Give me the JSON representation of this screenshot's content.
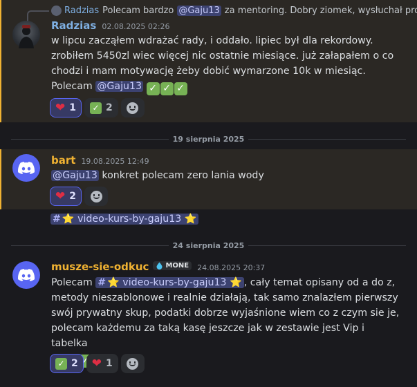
{
  "colors": {
    "mention_bg": "#2b2824",
    "mention_bar": "#f0b232",
    "blurple": "#5865f2"
  },
  "messages": [
    {
      "reply": {
        "author": "Radzias",
        "text_before": "Polecam bardzo",
        "mention": "@Gaju13",
        "text_after": "za mentoring. Dobry ziomek, wysłuchał pro..."
      },
      "author": "Radzias",
      "author_color": "#7fb0e3",
      "timestamp": "02.08.2025 02:26",
      "text": "w lipcu zacząłem wdrażać rady, i oddało. lipiec był dla rekordowy. zrobiłem 5450zl wiec więcej nic ostatnie miesiące. już załapałem o co chodzi i mam motywację żeby dobić wymarzone 10k w miesiąc. Polecam",
      "mention": "@Gaju13",
      "emoji_checks": 3,
      "reactions": [
        {
          "icon": "heart-icon",
          "count": "1",
          "me": true
        },
        {
          "icon": "check-icon",
          "count": "2",
          "me": false
        }
      ]
    },
    {
      "author": "bart",
      "author_color": "#f0b232",
      "timestamp": "19.08.2025 12:49",
      "mention": "@Gaju13",
      "text": "konkret polecam zero lania wody",
      "reactions": [
        {
          "icon": "heart-icon",
          "count": "2",
          "me": true
        }
      ]
    },
    {
      "author": "musze-sie-odkuc",
      "author_color": "#f0b232",
      "badge": "MONE",
      "timestamp": "24.08.2025 20:37",
      "text_before": "Polecam",
      "channel": "⭐ video-kurs-by-gaju13 ⭐",
      "text_after": ", cały temat opisany od a do z, metody nieszablonowe i realnie działają, tak samo znalazłem pierwszy swój prywatny skup, podatki dobrze wyjaśnione wiem co z czym sie je, polecam każdemu za taką kasę jeszcze jak w zestawie jest Vip i tabelka",
      "emoji_checks": 3,
      "reactions": [
        {
          "icon": "check-icon",
          "count": "2",
          "me": true
        },
        {
          "icon": "heart-icon",
          "count": "1",
          "me": false
        }
      ]
    }
  ],
  "channel_link": "⭐ video-kurs-by-gaju13 ⭐",
  "dividers": [
    "19 sierpnia 2025",
    "24 sierpnia 2025"
  ]
}
